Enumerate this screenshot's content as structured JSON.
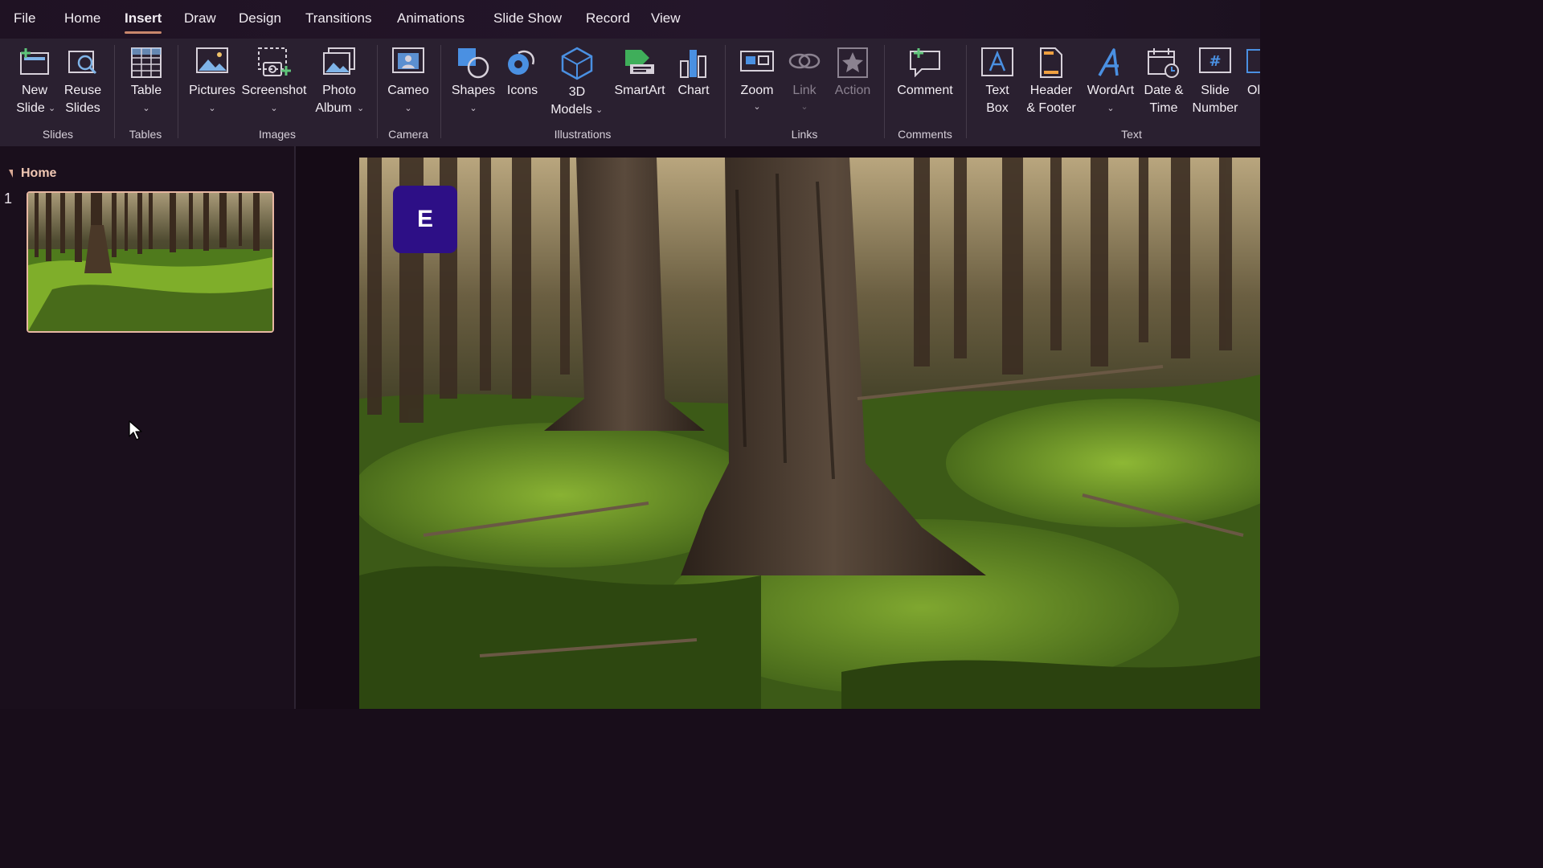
{
  "menu": {
    "tabs": [
      {
        "label": "File"
      },
      {
        "label": "Home"
      },
      {
        "label": "Insert"
      },
      {
        "label": "Draw"
      },
      {
        "label": "Design"
      },
      {
        "label": "Transitions"
      },
      {
        "label": "Animations"
      },
      {
        "label": "Slide Show"
      },
      {
        "label": "Record"
      },
      {
        "label": "View"
      }
    ],
    "active_tab": "Insert"
  },
  "ribbon": {
    "groups": {
      "slides": "Slides",
      "tables": "Tables",
      "images": "Images",
      "camera": "Camera",
      "illustrations": "Illustrations",
      "links": "Links",
      "comments": "Comments",
      "text": "Text"
    },
    "buttons": {
      "new_slide": {
        "line1": "New",
        "line2": "Slide",
        "icon": "new-slide-icon"
      },
      "reuse_slides": {
        "line1": "Reuse",
        "line2": "Slides",
        "icon": "reuse-slides-icon"
      },
      "table": {
        "line1": "Table",
        "icon": "table-icon"
      },
      "pictures": {
        "line1": "Pictures",
        "icon": "pictures-icon"
      },
      "screenshot": {
        "line1": "Screenshot",
        "icon": "screenshot-icon"
      },
      "photo_album": {
        "line1": "Photo",
        "line2": "Album",
        "icon": "photo-album-icon"
      },
      "cameo": {
        "line1": "Cameo",
        "icon": "cameo-icon"
      },
      "shapes": {
        "line1": "Shapes",
        "icon": "shapes-icon"
      },
      "icons": {
        "line1": "Icons",
        "icon": "icons-icon"
      },
      "models_3d": {
        "line1": "3D",
        "line2": "Models",
        "icon": "cube-icon"
      },
      "smartart": {
        "line1": "SmartArt",
        "icon": "smartart-icon"
      },
      "chart": {
        "line1": "Chart",
        "icon": "chart-icon"
      },
      "zoom": {
        "line1": "Zoom",
        "icon": "zoom-icon"
      },
      "link": {
        "line1": "Link",
        "icon": "link-icon",
        "disabled": true
      },
      "action": {
        "line1": "Action",
        "icon": "star-icon",
        "disabled": true
      },
      "comment": {
        "line1": "Comment",
        "icon": "comment-icon"
      },
      "text_box": {
        "line1": "Text",
        "line2": "Box",
        "icon": "text-box-icon"
      },
      "header_footer": {
        "line1": "Header",
        "line2": "& Footer",
        "icon": "header-footer-icon"
      },
      "wordart": {
        "line1": "WordArt",
        "icon": "wordart-icon"
      },
      "date_time": {
        "line1": "Date &",
        "line2": "Time",
        "icon": "calendar-icon"
      },
      "slide_number": {
        "line1": "Slide",
        "line2": "Number",
        "icon": "slide-number-icon"
      },
      "object_partial": {
        "line1": "Ol",
        "icon": "object-icon"
      }
    },
    "chevron": "⌄"
  },
  "slides_pane": {
    "section_title": "Home",
    "slides": [
      {
        "number": "1"
      }
    ]
  },
  "slide": {
    "badge_letter": "E"
  },
  "colors": {
    "accent": "#c9876c",
    "badge": "#2d0f86",
    "thumb_border": "#e7b7a2"
  }
}
